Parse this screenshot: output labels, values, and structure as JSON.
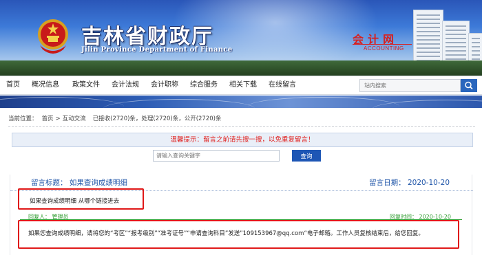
{
  "banner": {
    "title": "吉林省财政厅",
    "subtitle": "Jilin Province Department of Finance",
    "section_title": "会计网",
    "section_subtitle": "ACCOUNTING"
  },
  "nav": {
    "items": [
      "首页",
      "概况信息",
      "政策文件",
      "会计法规",
      "会计职称",
      "综合服务",
      "相关下载",
      "在线留言"
    ],
    "search_placeholder": "站内搜索"
  },
  "breadcrumb": {
    "label": "当前位置：",
    "home": "首页",
    "separator": ">",
    "current": "互动交流",
    "stats": "已接收(2720)条，处理(2720)条，公开(2720)条"
  },
  "tip": "温馨提示：留言之前请先搜一搜，以免重复留言！",
  "search": {
    "placeholder": "请输入查询关键字",
    "button": "查询"
  },
  "message": {
    "title": "留言标题：  如果查询成绩明细",
    "date": "留言日期：  2020-10-20",
    "body": "如果查询成绩明细 从哪个链接进去",
    "reply_by": "回复人：  管理员",
    "reply_time": "回复时间：  2020-10-20",
    "reply_body": "如果您查询成绩明细，请将您的“考区”“报考级别”“准考证号”“申请查询科目”发送”109153967@qq.com“电子邮箱。工作人员复核结束后，给您回复。"
  },
  "colors": {
    "link_blue": "#1f55a8",
    "tip_red": "#e0201e",
    "reply_green": "#2c9a2c",
    "highlight_red": "#e01818",
    "button_blue": "#1d56b5"
  }
}
